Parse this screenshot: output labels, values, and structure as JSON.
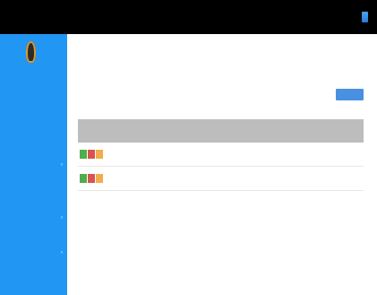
{
  "topbar": {
    "brand": "",
    "icon": "app-icon"
  },
  "sidebar": {
    "logo_subtitle": "",
    "items": [
      {
        "label": "",
        "has_caret": false
      },
      {
        "label": "",
        "has_caret": false
      },
      {
        "label": "",
        "has_caret": false
      },
      {
        "label": "",
        "has_caret": true
      },
      {
        "label": "",
        "has_caret": false
      },
      {
        "label": "",
        "has_caret": false
      },
      {
        "label": "",
        "has_caret": true
      },
      {
        "label": "",
        "has_caret": false
      },
      {
        "label": "",
        "has_caret": true
      },
      {
        "label": "",
        "has_caret": false
      }
    ]
  },
  "main": {
    "title": "",
    "subtitle": "",
    "subtitle_extra": "",
    "add_button_label": "",
    "right_label": "",
    "table": {
      "columns": [
        "",
        "",
        "",
        "",
        "",
        "",
        "",
        "",
        "",
        "",
        ""
      ],
      "rows": [
        {
          "action_labels": [
            "",
            "",
            ""
          ],
          "cells": [
            "",
            "",
            "",
            "",
            "",
            "",
            "",
            "",
            "",
            ""
          ]
        },
        {
          "action_labels": [
            "",
            "",
            ""
          ],
          "cells": [
            "",
            "",
            "",
            "",
            "",
            "",
            "",
            "",
            "",
            ""
          ]
        }
      ]
    }
  },
  "colors": {
    "topbar": "#000000",
    "sidebar": "#2196f3",
    "primary_button": "#4a90e2",
    "action_green": "#4cae4c",
    "action_red": "#d9534f",
    "action_orange": "#f0ad4e",
    "header_gray": "#bdbdbd"
  },
  "icons": {
    "logo": "app-logo",
    "top_right": "app-icon",
    "caret": "chevron-right-icon"
  }
}
